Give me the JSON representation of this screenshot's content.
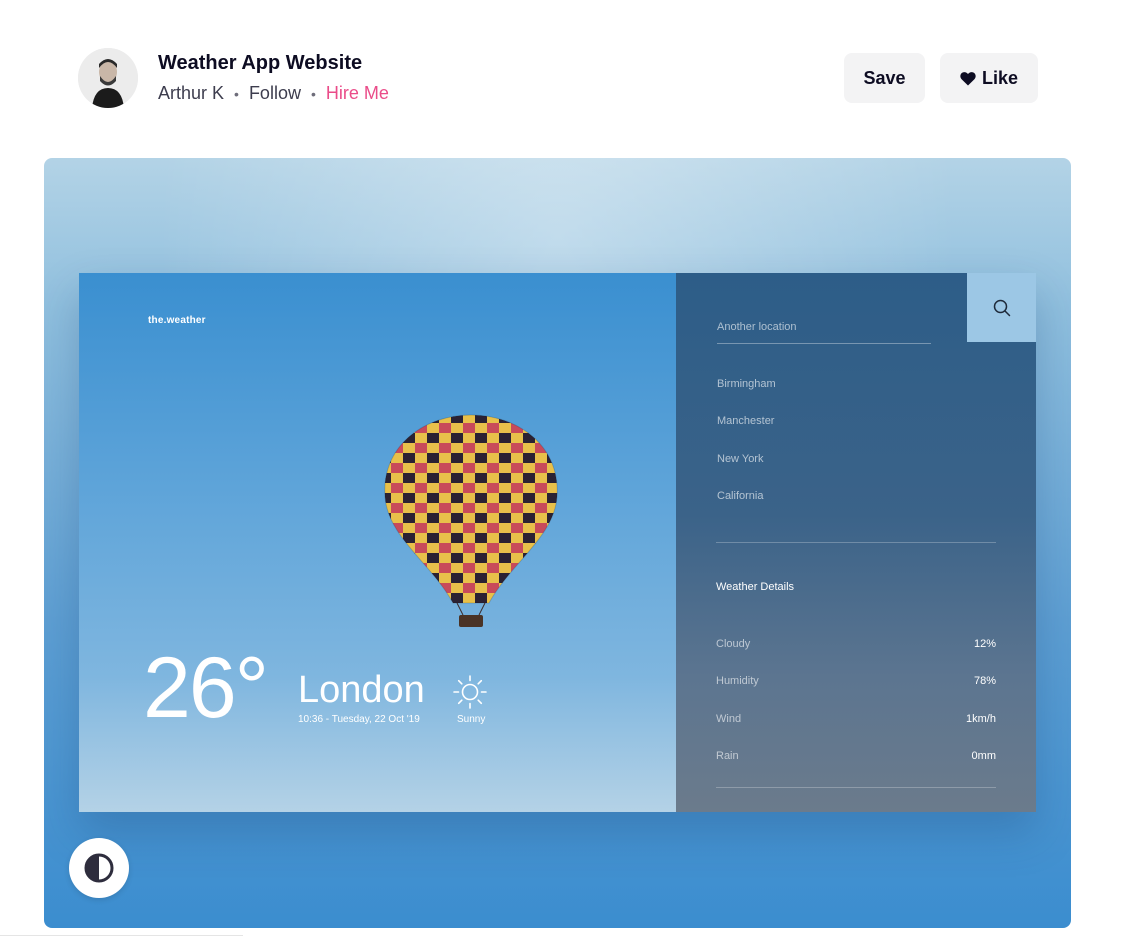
{
  "header": {
    "title": "Weather App Website",
    "author": "Arthur K",
    "follow_label": "Follow",
    "hire_label": "Hire Me",
    "save_label": "Save",
    "like_label": "Like"
  },
  "shot": {
    "brand": "the.weather",
    "current": {
      "temperature": "26°",
      "city": "London",
      "datetime": "10:36 - Tuesday, 22 Oct '19",
      "condition": "Sunny"
    },
    "sidebar": {
      "search_placeholder": "Another location",
      "locations": [
        "Birmingham",
        "Manchester",
        "New York",
        "California"
      ],
      "details_title": "Weather Details",
      "details": [
        {
          "label": "Cloudy",
          "value": "12%"
        },
        {
          "label": "Humidity",
          "value": "78%"
        },
        {
          "label": "Wind",
          "value": "1km/h"
        },
        {
          "label": "Rain",
          "value": "0mm"
        }
      ]
    }
  },
  "icons": {
    "search": "search-icon",
    "heart": "heart-icon",
    "sun": "sun-icon",
    "contrast": "contrast-icon"
  },
  "colors": {
    "accent": "#ea4c89",
    "button_bg": "#f3f3f4",
    "search_button_bg": "#9cc7e5"
  }
}
